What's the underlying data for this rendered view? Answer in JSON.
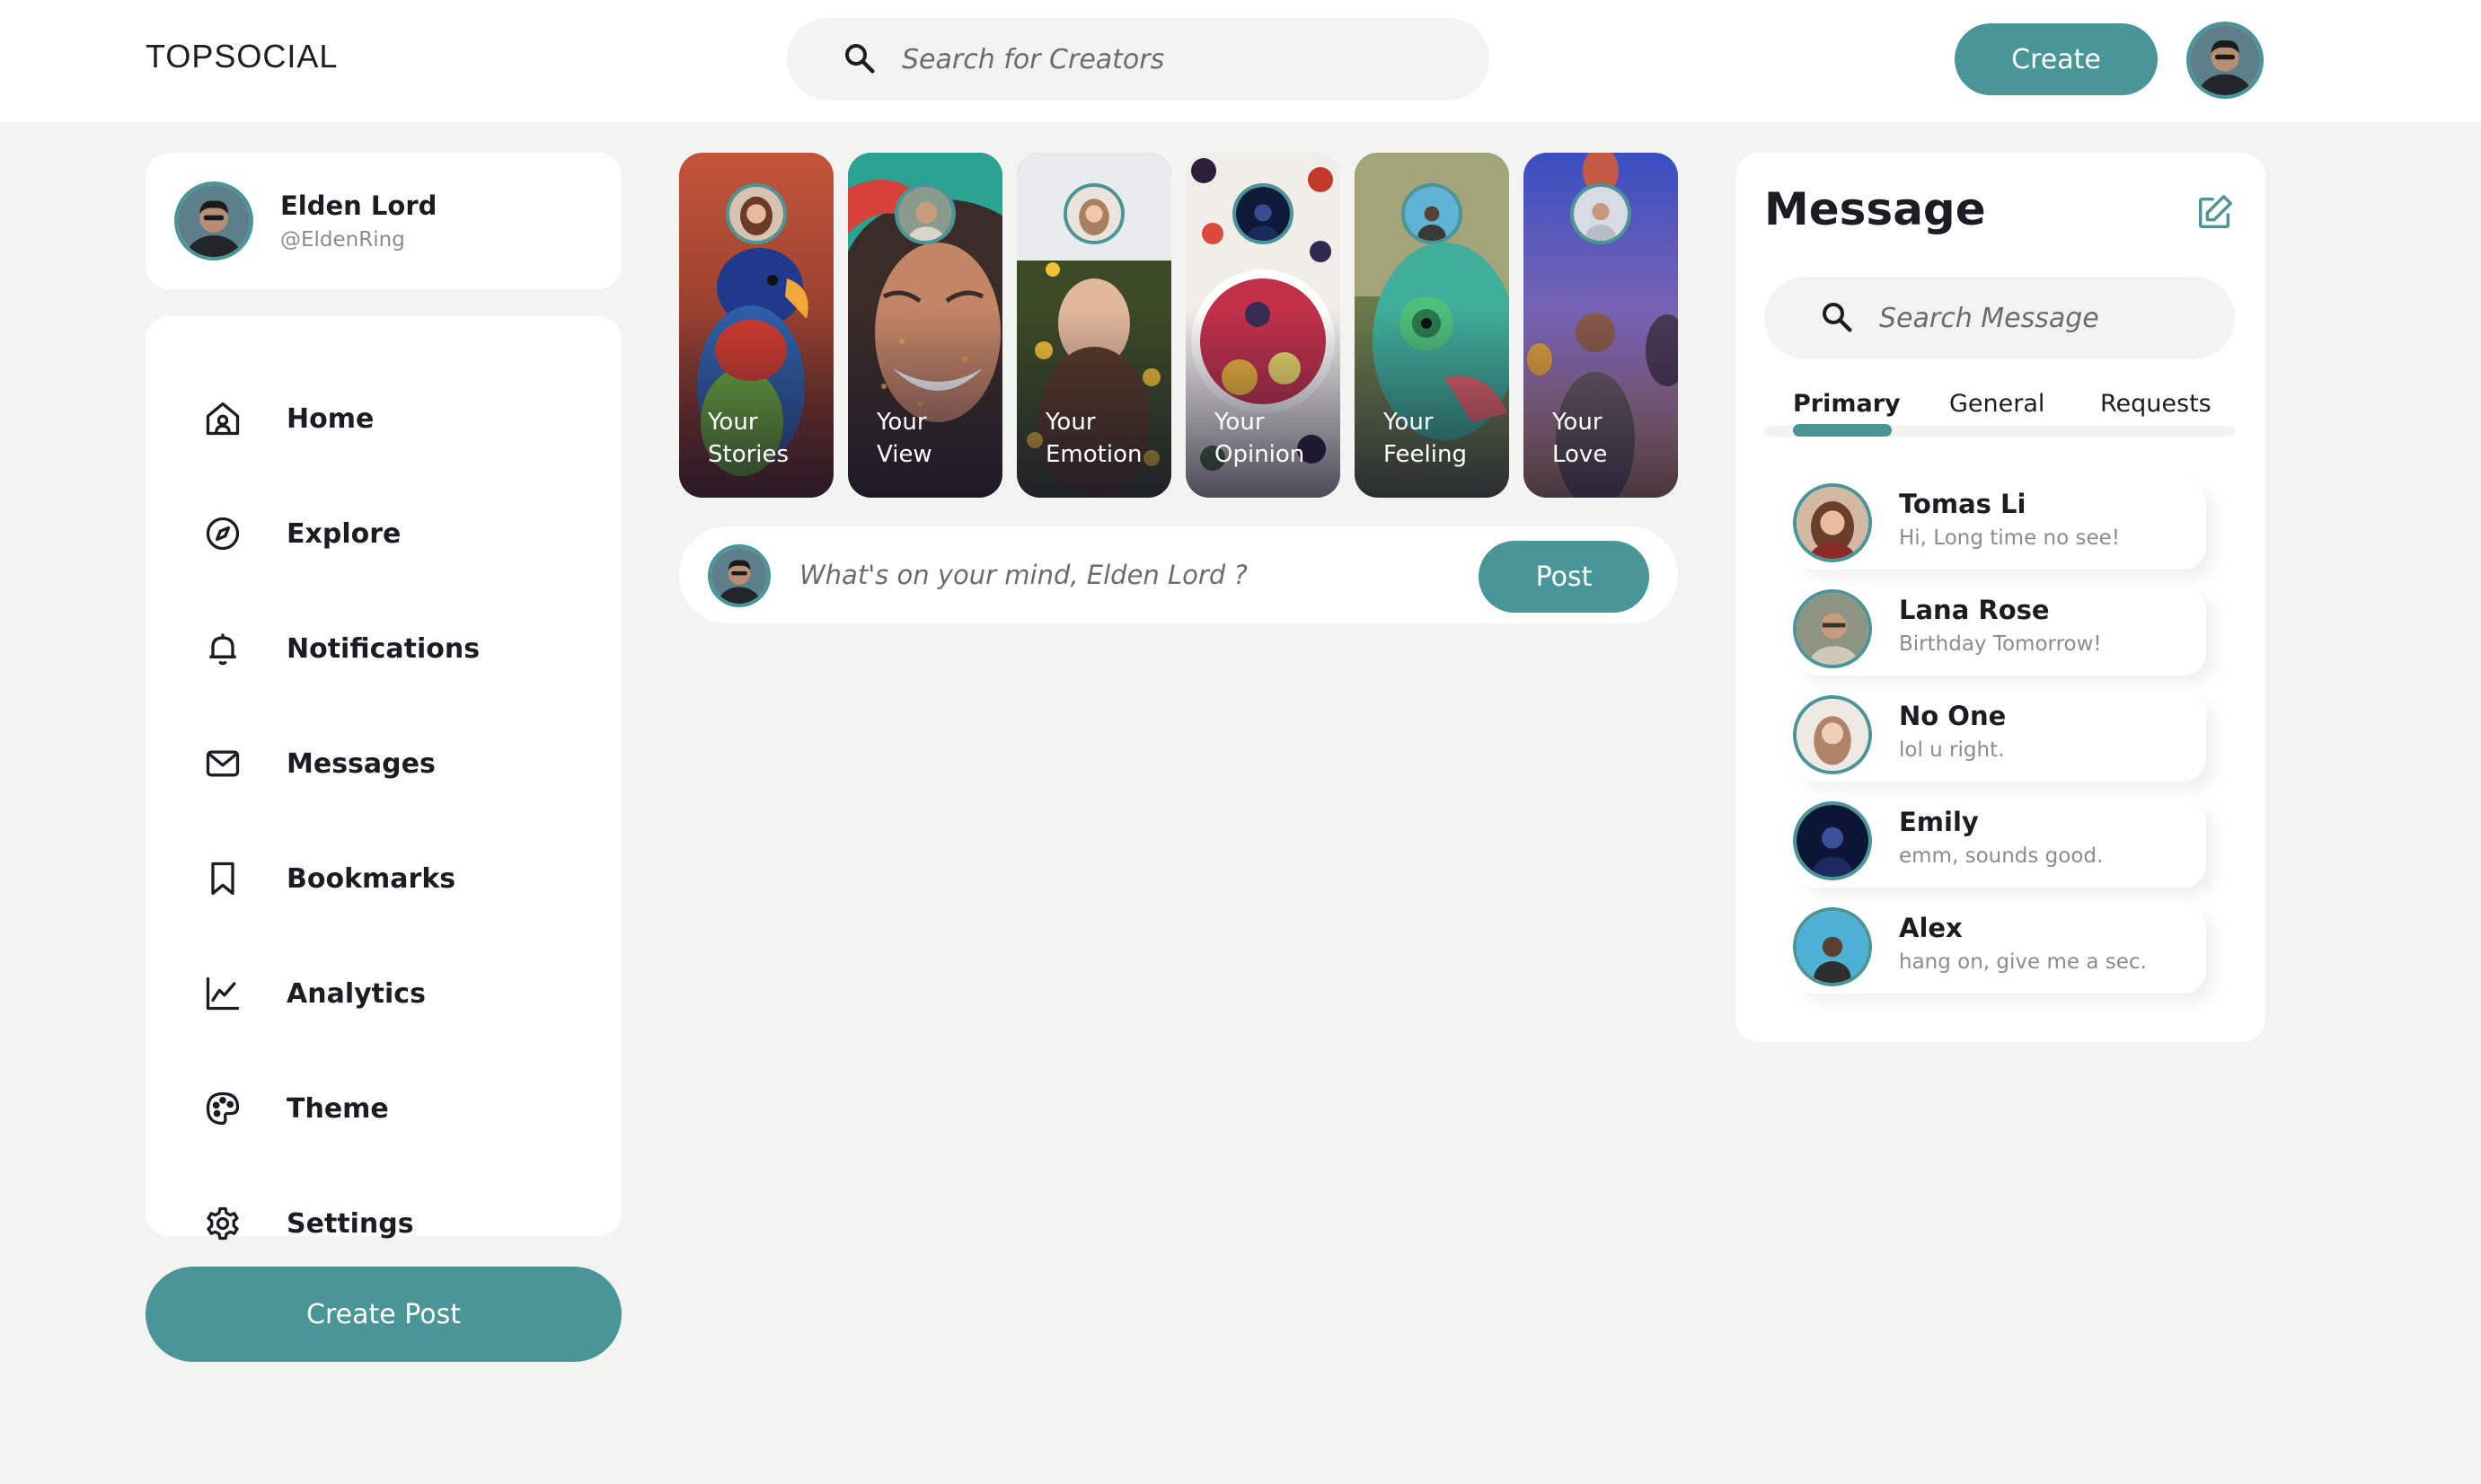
{
  "header": {
    "logo": "TOPSOCIAL",
    "search_placeholder": "Search for Creators",
    "create_label": "Create"
  },
  "profile": {
    "name": "Elden Lord",
    "handle": "@EldenRing"
  },
  "nav": {
    "items": [
      {
        "label": "Home",
        "icon": "home-icon"
      },
      {
        "label": "Explore",
        "icon": "compass-icon"
      },
      {
        "label": "Notifications",
        "icon": "bell-icon"
      },
      {
        "label": "Messages",
        "icon": "envelope-icon"
      },
      {
        "label": "Bookmarks",
        "icon": "bookmark-icon"
      },
      {
        "label": "Analytics",
        "icon": "chart-icon"
      },
      {
        "label": "Theme",
        "icon": "palette-icon"
      },
      {
        "label": "Settings",
        "icon": "gear-icon"
      }
    ],
    "create_post_label": "Create Post"
  },
  "stories": [
    {
      "line1": "Your",
      "line2": "Stories"
    },
    {
      "line1": "Your",
      "line2": "View"
    },
    {
      "line1": "Your",
      "line2": "Emotion"
    },
    {
      "line1": "Your",
      "line2": "Opinion"
    },
    {
      "line1": "Your",
      "line2": "Feeling"
    },
    {
      "line1": "Your",
      "line2": "Love"
    }
  ],
  "composer": {
    "placeholder": "What's on your mind, Elden Lord ?",
    "post_label": "Post"
  },
  "messages": {
    "title": "Message",
    "search_placeholder": "Search Message",
    "tabs": [
      "Primary",
      "General",
      "Requests"
    ],
    "active_tab": "Primary",
    "items": [
      {
        "name": "Tomas Li",
        "text": "Hi, Long time no see!"
      },
      {
        "name": "Lana Rose",
        "text": "Birthday Tomorrow!"
      },
      {
        "name": "No One",
        "text": "lol u right."
      },
      {
        "name": "Emily",
        "text": "emm, sounds good."
      },
      {
        "name": "Alex",
        "text": "hang on, give me a sec."
      }
    ]
  },
  "colors": {
    "accent": "#4a9597",
    "background": "#f3f3f1",
    "card": "#ffffff",
    "text": "#1c1c24",
    "muted": "#8b8b90"
  }
}
